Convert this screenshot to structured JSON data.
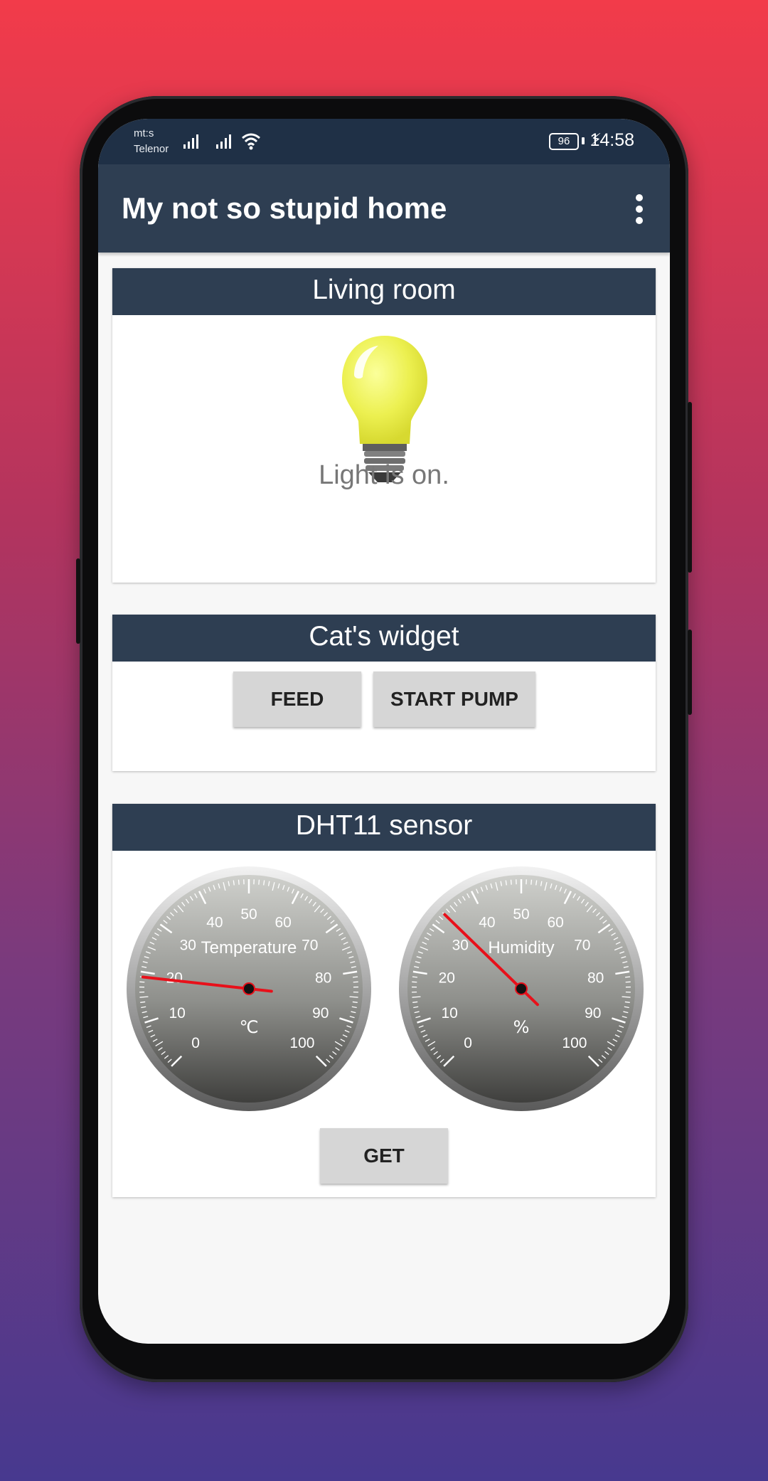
{
  "status_bar": {
    "carrier_line1": "mt:s",
    "carrier_line2": "Telenor",
    "battery": "96",
    "time": "14:58"
  },
  "app_bar": {
    "title": "My not so stupid home",
    "menu_icon": "more-vert-icon"
  },
  "living_room": {
    "title": "Living room",
    "bulb_icon": "lightbulb-icon",
    "status": "Light is on."
  },
  "cat_widget": {
    "title": "Cat's widget",
    "feed_label": "FEED",
    "pump_label": "START PUMP"
  },
  "sensor": {
    "title": "DHT11 sensor",
    "temperature": {
      "label": "Temperature",
      "unit": "℃",
      "value": 19,
      "ticks": [
        "0",
        "10",
        "20",
        "30",
        "40",
        "50",
        "60",
        "70",
        "80",
        "90",
        "100"
      ]
    },
    "humidity": {
      "label": "Humidity",
      "unit": "%",
      "value": 33,
      "ticks": [
        "0",
        "10",
        "20",
        "30",
        "40",
        "50",
        "60",
        "70",
        "80",
        "90",
        "100"
      ]
    },
    "get_label": "GET"
  },
  "colors": {
    "header": "#2e3e52",
    "status_bar": "#1f3046",
    "needle": "#e8101a"
  }
}
